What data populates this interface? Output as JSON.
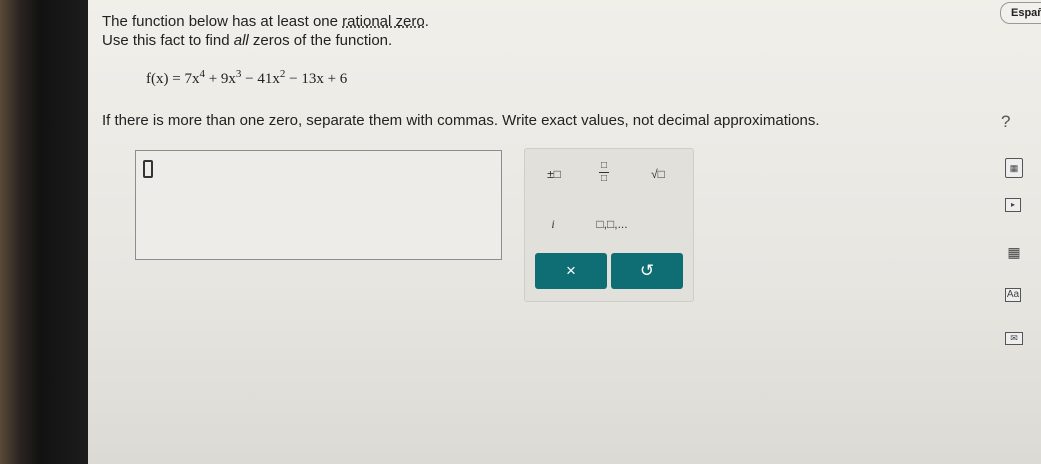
{
  "problem": {
    "line1_pre": "The function below has at least one ",
    "line1_link": "rational zero",
    "line1_post": ".",
    "line2_pre": "Use this fact to find ",
    "line2_em": "all",
    "line2_post": " zeros of the function.",
    "formula": {
      "lhs": "f(x) = 7x",
      "e1": "4",
      "t2": " + 9x",
      "e2": "3",
      "t3": " − 41x",
      "e3": "2",
      "t4": " − 13x + 6"
    },
    "instructions": "If there is more than one zero, separate them with commas. Write exact values, not decimal approximations."
  },
  "keypad": {
    "plus_minus": "±□",
    "fraction_top": "□",
    "fraction_bottom": "□",
    "sqrt": "√□",
    "imag": "i",
    "list": "□,□,...",
    "clear": "×",
    "undo": "↺"
  },
  "ui": {
    "help": "?",
    "language": "Españ",
    "calc_icon": "▦",
    "play_icon": "▸",
    "grid_icon": "▦",
    "aa_icon": "Aa",
    "mail_icon": "✉"
  }
}
